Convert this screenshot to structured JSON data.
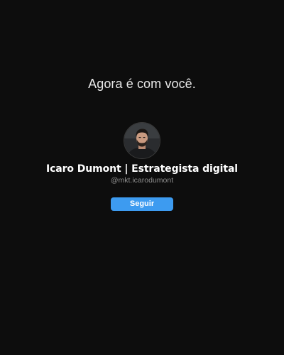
{
  "header": {
    "title": "Agora é com você."
  },
  "profile": {
    "name": "Icaro Dumont | Estrategista digital",
    "handle": "@mkt.icarodumont",
    "avatar_icon": "profile-photo"
  },
  "actions": {
    "follow_label": "Seguir"
  },
  "colors": {
    "background": "#0d0d0d",
    "accent": "#3d9bf0",
    "muted_text": "#8e8e8e"
  }
}
